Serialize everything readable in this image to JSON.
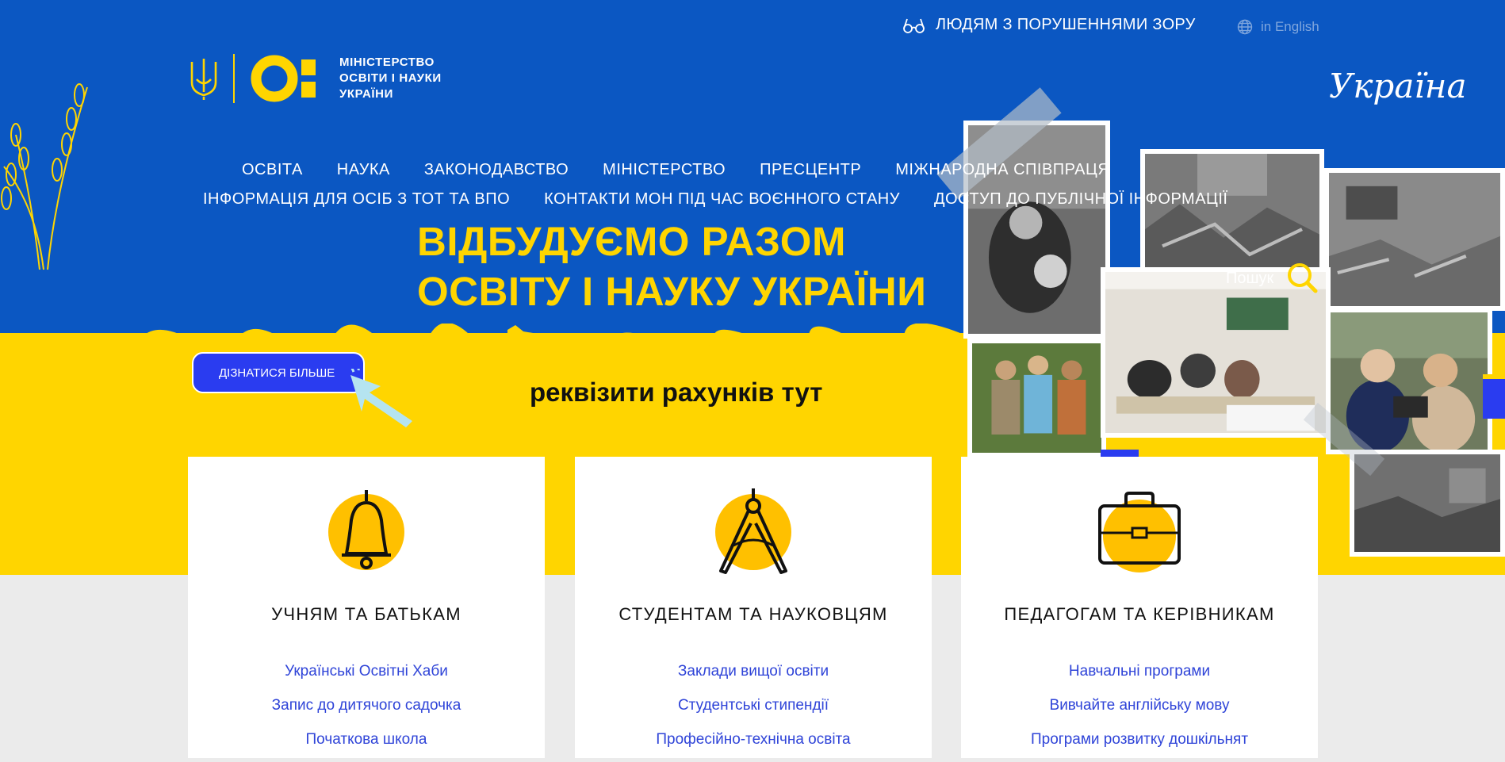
{
  "header": {
    "accessibility_label": "ЛЮДЯМ З ПОРУШЕННЯМИ ЗОРУ",
    "language_label": "in English",
    "logo_lines": [
      "МІНІСТЕРСТВО",
      "ОСВІТИ І НАУКИ",
      "УКРАЇНИ"
    ],
    "ukraine_script": "Україна"
  },
  "nav": {
    "row1": [
      "ОСВІТА",
      "НАУКА",
      "ЗАКОНОДАВСТВО",
      "МІНІСТЕРСТВО",
      "ПРЕСЦЕНТР",
      "МІЖНАРОДНА СПІВПРАЦЯ"
    ],
    "row2": [
      "ІНФОРМАЦІЯ ДЛЯ ОСІБ З ТОТ ТА ВПО",
      "КОНТАКТИ МОН ПІД ЧАС ВОЄННОГО СТАНУ",
      "ДОСТУП ДО ПУБЛІЧНОЇ ІНФОРМАЦІЇ"
    ]
  },
  "hero": {
    "headline_line1": "ВІДБУДУЄМО РАЗОМ",
    "headline_line2": "ОСВІТУ І НАУКУ УКРАЇНИ",
    "button_label": "ДІЗНАТИСЯ БІЛЬШЕ",
    "requisites": "реквізити рахунків тут",
    "search_label": "Пошук"
  },
  "colors": {
    "brand_blue": "#0b57c2",
    "brand_yellow": "#ffd500",
    "link_blue": "#2f44d8",
    "button_blue": "#2a3cf0"
  },
  "cards": [
    {
      "icon": "bell-icon",
      "title": "УЧНЯМ ТА БАТЬКАМ",
      "links": [
        "Українські Освітні Хаби",
        "Запис до дитячого садочка",
        "Початкова школа"
      ]
    },
    {
      "icon": "compass-icon",
      "title": "СТУДЕНТАМ ТА НАУКОВЦЯМ",
      "links": [
        "Заклади вищої освіти",
        "Студентські стипендії",
        "Професійно-технічна освіта"
      ]
    },
    {
      "icon": "briefcase-icon",
      "title": "ПЕДАГОГАМ ТА КЕРІВНИКАМ",
      "links": [
        "Навчальні програми",
        "Вивчайте англійську мову",
        "Програми розвитку дошкільнят"
      ]
    }
  ]
}
